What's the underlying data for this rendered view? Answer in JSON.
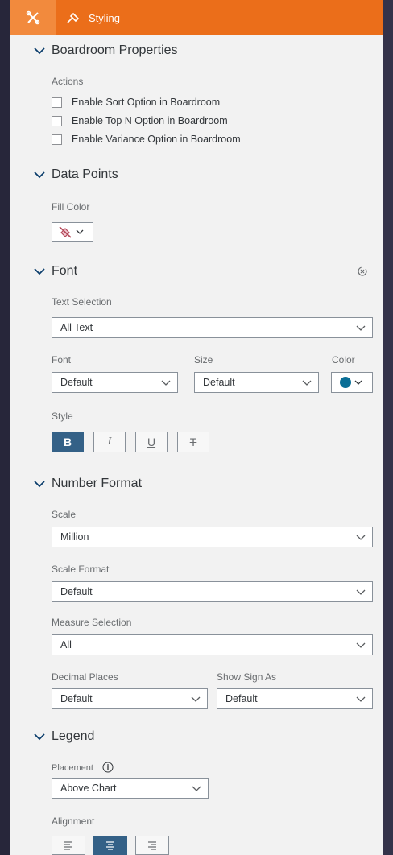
{
  "tabs": {
    "styling_label": "Styling"
  },
  "boardroom": {
    "title": "Boardroom Properties",
    "actions_label": "Actions",
    "options": [
      "Enable Sort Option in Boardroom",
      "Enable Top N Option in Boardroom",
      "Enable Variance Option in Boardroom"
    ]
  },
  "data_points": {
    "title": "Data Points",
    "fill_label": "Fill Color"
  },
  "font": {
    "title": "Font",
    "text_selection_label": "Text Selection",
    "text_selection_value": "All Text",
    "font_label": "Font",
    "font_value": "Default",
    "size_label": "Size",
    "size_value": "Default",
    "color_label": "Color",
    "color_value": "#0a6e96",
    "style_label": "Style",
    "style_buttons": [
      "B",
      "I",
      "U",
      "T"
    ]
  },
  "number_format": {
    "title": "Number Format",
    "scale_label": "Scale",
    "scale_value": "Million",
    "scale_format_label": "Scale Format",
    "scale_format_value": "Default",
    "measure_label": "Measure Selection",
    "measure_value": "All",
    "decimal_label": "Decimal Places",
    "decimal_value": "Default",
    "sign_label": "Show Sign As",
    "sign_value": "Default"
  },
  "legend": {
    "title": "Legend",
    "placement_label": "Placement",
    "placement_value": "Above Chart",
    "alignment_label": "Alignment"
  },
  "colors": {
    "accent": "#eb6e1a",
    "active_button": "#346187"
  }
}
